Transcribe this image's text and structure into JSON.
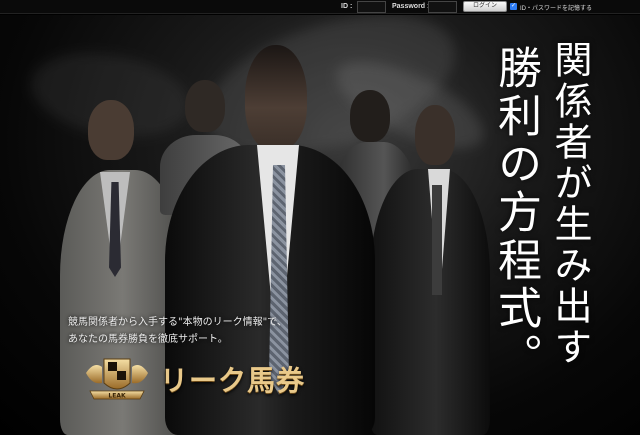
{
  "login": {
    "id_label": "ID :",
    "password_label": "Password :",
    "button_label": "ログイン",
    "remember_label": "ID・パスワードを記憶する",
    "remember_checked": true
  },
  "hero": {
    "headline_line1": "関係者が生み出す",
    "headline_line2": "勝利の方程式。",
    "subtext_line1": "競馬関係者から入手する\"本物のリーク情報\"で、",
    "subtext_line2": "あなたの馬券勝負を徹底サポート。",
    "logo_text": "リーク馬券",
    "emblem_text": "LEAK"
  },
  "colors": {
    "background": "#000000",
    "headline": "#ffffff",
    "logo_gold": "#e9c98a",
    "checkbox": "#2d7cf6"
  }
}
